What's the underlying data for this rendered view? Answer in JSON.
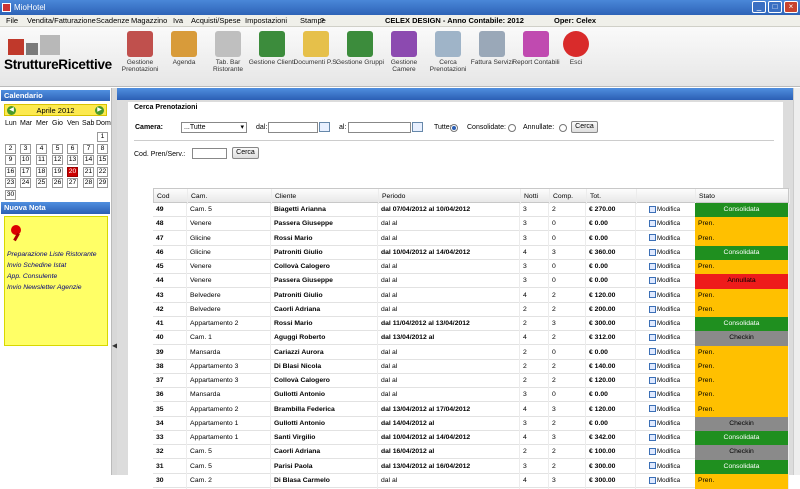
{
  "app": {
    "title": "MioHotel"
  },
  "menu": {
    "items": [
      "File",
      "Vendita/Fatturazione",
      "Scadenze",
      "Magazzino",
      "Iva",
      "Acquisti/Spese",
      "Impostazioni",
      "Stampe",
      "?"
    ],
    "company": "CELEX DESIGN - Anno Contabile: 2012",
    "operator": "Oper: Celex"
  },
  "logo": {
    "text": "StruttureRicettive"
  },
  "toolbar": {
    "buttons": [
      {
        "label": "Gestione Prenotazioni",
        "icon": "calendar-edit-icon",
        "color": "#c0504d"
      },
      {
        "label": "Agenda",
        "icon": "agenda-calendar-icon",
        "color": "#d89b3a"
      },
      {
        "label": "Tab. Bar Ristorante",
        "icon": "cutlery-icon",
        "color": "#bfbfbf"
      },
      {
        "label": "Gestione Clienti",
        "icon": "client-user-icon",
        "color": "#3c8c3c"
      },
      {
        "label": "Documenti P.S.",
        "icon": "documents-folder-icon",
        "color": "#e6c04a"
      },
      {
        "label": "Gestione Gruppi",
        "icon": "group-users-icon",
        "color": "#3c8c3c"
      },
      {
        "label": "Gestione Camere",
        "icon": "cash-register-icon",
        "color": "#8c4ab0"
      },
      {
        "label": "Cerca Prenotazioni",
        "icon": "search-magnifier-icon",
        "color": "#9fb4c8"
      },
      {
        "label": "Fattura Servizi",
        "icon": "invoice-icon",
        "color": "#9aa8b8"
      },
      {
        "label": "Report Contabili",
        "icon": "report-chart-icon",
        "color": "#c04ab0"
      },
      {
        "label": "Esci",
        "icon": "power-exit-icon",
        "color": "#d92b2b"
      }
    ]
  },
  "calendar": {
    "header": "Calendario",
    "month": "Aprile 2012",
    "weekdays": [
      "Lun",
      "Mar",
      "Mer",
      "Gio",
      "Ven",
      "Sab",
      "Dom"
    ],
    "today": 20,
    "days": 30,
    "first_col": 6
  },
  "note": {
    "header": "Nuova Nota",
    "lines": [
      "Preparazione Liste Ristorante",
      "Invio Schedine Istat",
      "App. Consulente",
      "Invio Newsletter Agenzie"
    ]
  },
  "search": {
    "title": "Cerca Prenotazioni",
    "camera_label": "Camera:",
    "camera_value": "...Tutte",
    "dal_label": "dal:",
    "al_label": "al:",
    "tutte_label": "Tutte:",
    "consolidate_label": "Consolidate:",
    "annullate_label": "Annullate:",
    "cerca_label": "Cerca",
    "codpren_label": "Cod. Pren/Serv.:",
    "cerca2_label": "Cerca"
  },
  "table": {
    "columns": [
      "Cod",
      "Cam.",
      "Cliente",
      "Periodo",
      "Notti",
      "Comp.",
      "Tot.",
      "",
      "Stato"
    ],
    "modifica": "Modifica",
    "status_colors": {
      "Consolidata": "#1f8f1f",
      "Pren.": "#ffc000",
      "Annullata": "#ee1b1b",
      "Checkin": "#8a8a8a"
    },
    "rows": [
      {
        "cod": "49",
        "cam": "Cam. 5",
        "cliente": "Biagetti Arianna",
        "periodo": "dal 07/04/2012 al 10/04/2012",
        "notti": "3",
        "comp": "2",
        "tot": "€ 270.00",
        "stato": "Consolidata"
      },
      {
        "cod": "48",
        "cam": "Venere",
        "cliente": "Passera Giuseppe",
        "periodo": "dal al",
        "notti": "3",
        "comp": "0",
        "tot": "€ 0.00",
        "stato": "Pren."
      },
      {
        "cod": "47",
        "cam": "Glicine",
        "cliente": "Rossi Mario",
        "periodo": "dal al",
        "notti": "3",
        "comp": "0",
        "tot": "€ 0.00",
        "stato": "Pren."
      },
      {
        "cod": "46",
        "cam": "Glicine",
        "cliente": "Patroniti Giulio",
        "periodo": "dal 10/04/2012 al 14/04/2012",
        "notti": "4",
        "comp": "3",
        "tot": "€ 360.00",
        "stato": "Consolidata"
      },
      {
        "cod": "45",
        "cam": "Venere",
        "cliente": "Collovà Calogero",
        "periodo": "dal al",
        "notti": "3",
        "comp": "0",
        "tot": "€ 0.00",
        "stato": "Pren."
      },
      {
        "cod": "44",
        "cam": "Venere",
        "cliente": "Passera Giuseppe",
        "periodo": "dal al",
        "notti": "3",
        "comp": "0",
        "tot": "€ 0.00",
        "stato": "Annullata"
      },
      {
        "cod": "43",
        "cam": "Belvedere",
        "cliente": "Patroniti Giulio",
        "periodo": "dal al",
        "notti": "4",
        "comp": "2",
        "tot": "€ 120.00",
        "stato": "Pren."
      },
      {
        "cod": "42",
        "cam": "Belvedere",
        "cliente": "Caorli Adriana",
        "periodo": "dal al",
        "notti": "2",
        "comp": "2",
        "tot": "€ 200.00",
        "stato": "Pren."
      },
      {
        "cod": "41",
        "cam": "Appartamento 2",
        "cliente": "Rossi Mario",
        "periodo": "dal 11/04/2012 al 13/04/2012",
        "notti": "2",
        "comp": "3",
        "tot": "€ 300.00",
        "stato": "Consolidata"
      },
      {
        "cod": "40",
        "cam": "Cam. 1",
        "cliente": "Aguggi Roberto",
        "periodo": "dal 13/04/2012 al",
        "notti": "4",
        "comp": "2",
        "tot": "€ 312.00",
        "stato": "Checkin"
      },
      {
        "cod": "39",
        "cam": "Mansarda",
        "cliente": "Cariazzi Aurora",
        "periodo": "dal al",
        "notti": "2",
        "comp": "0",
        "tot": "€ 0.00",
        "stato": "Pren."
      },
      {
        "cod": "38",
        "cam": "Appartamento 3",
        "cliente": "Di Blasi Nicola",
        "periodo": "dal al",
        "notti": "2",
        "comp": "2",
        "tot": "€ 140.00",
        "stato": "Pren."
      },
      {
        "cod": "37",
        "cam": "Appartamento 3",
        "cliente": "Collovà Calogero",
        "periodo": "dal al",
        "notti": "2",
        "comp": "2",
        "tot": "€ 120.00",
        "stato": "Pren."
      },
      {
        "cod": "36",
        "cam": "Mansarda",
        "cliente": "Gullotti Antonio",
        "periodo": "dal al",
        "notti": "3",
        "comp": "0",
        "tot": "€ 0.00",
        "stato": "Pren."
      },
      {
        "cod": "35",
        "cam": "Appartamento 2",
        "cliente": "Brambilla Federica",
        "periodo": "dal 13/04/2012 al 17/04/2012",
        "notti": "4",
        "comp": "3",
        "tot": "€ 120.00",
        "stato": "Pren."
      },
      {
        "cod": "34",
        "cam": "Appartamento 1",
        "cliente": "Gullotti Antonio",
        "periodo": "dal 14/04/2012 al",
        "notti": "3",
        "comp": "2",
        "tot": "€ 0.00",
        "stato": "Checkin"
      },
      {
        "cod": "33",
        "cam": "Appartamento 1",
        "cliente": "Santi Virgilio",
        "periodo": "dal 10/04/2012 al 14/04/2012",
        "notti": "4",
        "comp": "3",
        "tot": "€ 342.00",
        "stato": "Consolidata"
      },
      {
        "cod": "32",
        "cam": "Cam. 5",
        "cliente": "Caorli Adriana",
        "periodo": "dal 16/04/2012 al",
        "notti": "2",
        "comp": "2",
        "tot": "€ 100.00",
        "stato": "Checkin"
      },
      {
        "cod": "31",
        "cam": "Cam. 5",
        "cliente": "Parisi Paola",
        "periodo": "dal 13/04/2012 al 16/04/2012",
        "notti": "3",
        "comp": "2",
        "tot": "€ 300.00",
        "stato": "Consolidata"
      },
      {
        "cod": "30",
        "cam": "Cam. 2",
        "cliente": "Di Blasa Carmelo",
        "periodo": "dal al",
        "notti": "4",
        "comp": "3",
        "tot": "€ 300.00",
        "stato": "Pren."
      }
    ]
  }
}
